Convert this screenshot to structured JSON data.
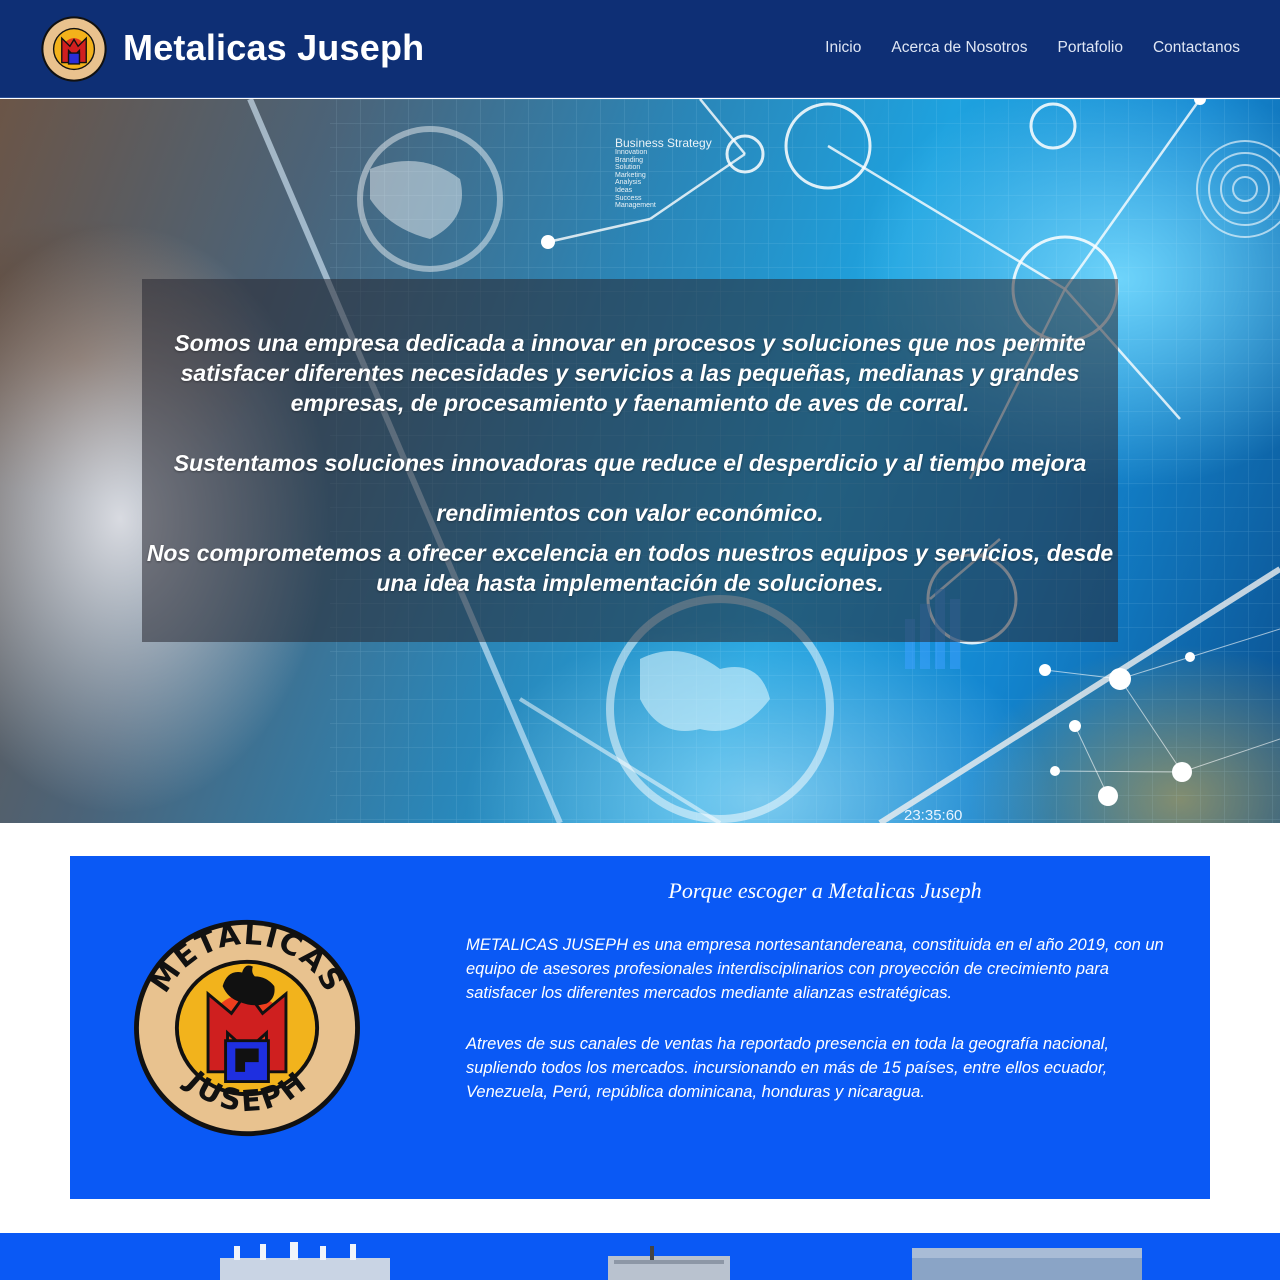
{
  "header": {
    "brand_title": "Metalicas Juseph",
    "nav": [
      {
        "label": "Inicio"
      },
      {
        "label": "Acerca de Nosotros"
      },
      {
        "label": "Portafolio"
      },
      {
        "label": "Contactanos"
      }
    ],
    "background_color": "#0e2f75"
  },
  "logo": {
    "top_text": "METALICAS",
    "bottom_text": "JUSEPH",
    "icon": "rooster-m-logo-icon"
  },
  "hero": {
    "paragraph_1": "Somos una empresa dedicada a innovar en procesos y soluciones que nos permite satisfacer diferentes necesidades y servicios a las pequeñas, medianas y grandes empresas, de procesamiento y faenamiento de aves de corral.",
    "paragraph_2": "Sustentamos soluciones innovadoras que reduce el desperdicio y al tiempo mejora rendimientos con valor económico.",
    "paragraph_3": "Nos comprometemos a ofrecer excelencia en todos nuestros equipos y servicios, desde una idea hasta implementación de soluciones.",
    "image_overlay_title": "Business Strategy",
    "image_overlay_list": [
      "Innovation",
      "Branding",
      "Solution",
      "Marketing",
      "Analysis",
      "Ideas",
      "Success",
      "Management"
    ],
    "image_clock": "23:35:60"
  },
  "why": {
    "title": "Porque escoger a Metalicas Juseph",
    "paragraph_1": "METALICAS JUSEPH es una empresa nortesantandereana, constituida en el año 2019, con un equipo de asesores profesionales interdisciplinarios con proyección de crecimiento para satisfacer los diferentes mercados mediante alianzas estratégicas.",
    "paragraph_2": "Atreves de sus canales de ventas ha reportado presencia en toda la geografía nacional, supliendo todos los mercados. incursionando en más de 15 países, entre ellos ecuador, Venezuela, Perú, república dominicana, honduras y nicaragua.",
    "background_color": "#0a59f5"
  }
}
